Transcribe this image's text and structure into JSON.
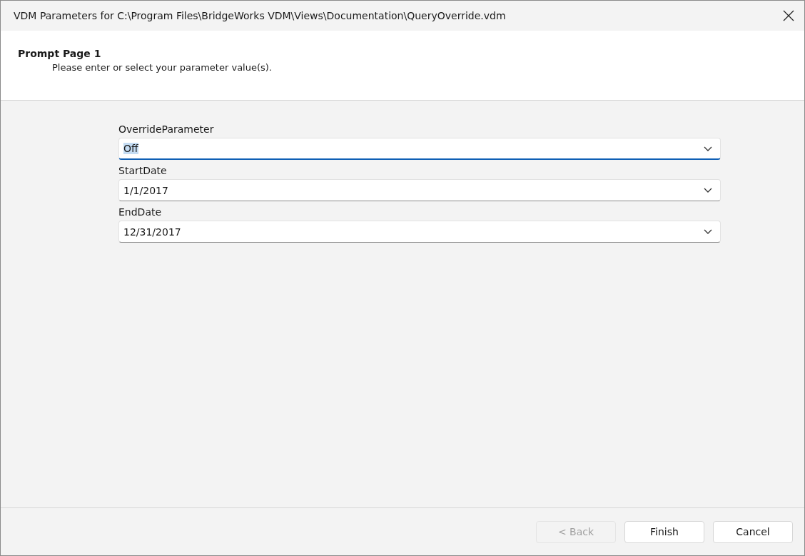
{
  "window": {
    "title": "VDM Parameters for C:\\Program Files\\BridgeWorks VDM\\Views\\Documentation\\QueryOverride.vdm"
  },
  "header": {
    "title": "Prompt Page 1",
    "subtitle": "Please enter or select your parameter value(s)."
  },
  "fields": [
    {
      "label": "OverrideParameter",
      "value": "Off",
      "focused": true
    },
    {
      "label": "StartDate",
      "value": "1/1/2017",
      "focused": false
    },
    {
      "label": "EndDate",
      "value": "12/31/2017",
      "focused": false
    }
  ],
  "buttons": [
    {
      "label": "< Back",
      "disabled": true
    },
    {
      "label": "Finish",
      "disabled": false
    },
    {
      "label": "Cancel",
      "disabled": false
    }
  ]
}
